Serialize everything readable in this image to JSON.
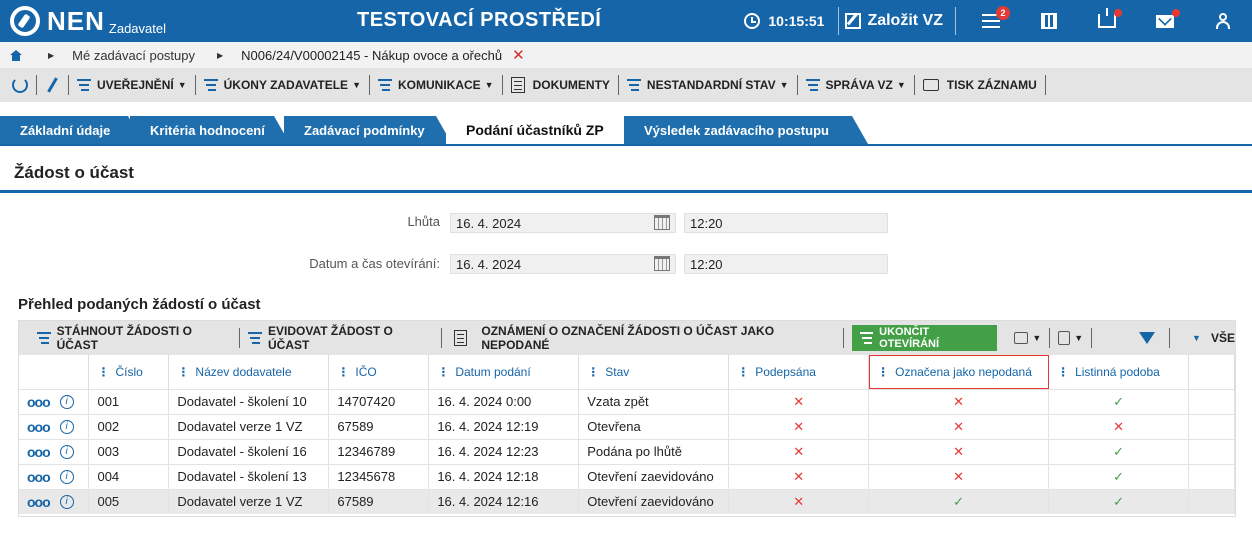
{
  "header": {
    "logo_text": "NEN",
    "logo_sub": "Zadavatel",
    "env_title": "TESTOVACÍ PROSTŘEDÍ",
    "clock": "10:15:51",
    "new_vz_label": "Založit VZ",
    "notif_count": "2",
    "accent": "#1565a8"
  },
  "breadcrumb": {
    "item1": "Mé zadávací postupy",
    "item2": "N006/24/V00002145 - Nákup ovoce a ořechů",
    "close": "✕"
  },
  "actionbar": {
    "items": [
      "UVEŘEJNĚNÍ",
      "ÚKONY ZADAVATELE",
      "KOMUNIKACE",
      "DOKUMENTY",
      "NESTANDARDNÍ STAV",
      "SPRÁVA VZ",
      "TISK ZÁZNAMU"
    ]
  },
  "tabs": [
    "Základní údaje",
    "Kritéria hodnocení",
    "Zadávací podmínky",
    "Podání účastníků ZP",
    "Výsledek zadávacího postupu"
  ],
  "section": {
    "title": "Žádost o účast",
    "lhuta_label": "Lhůta",
    "lhuta_date": "16. 4. 2024",
    "lhuta_time": "12:20",
    "opening_label": "Datum a čas otevírání:",
    "opening_date": "16. 4. 2024",
    "opening_time": "12:20"
  },
  "list": {
    "title": "Přehled podaných žádostí o účast",
    "toolbar": {
      "download": "STÁHNOUT ŽÁDOSTI O ÚČAST",
      "register": "EVIDOVAT ŽÁDOST O ÚČAST",
      "notice": "OZNÁMENÍ O OZNAČENÍ ŽÁDOSTI O ÚČAST JAKO NEPODANÉ",
      "finish": "UKONČIT OTEVÍRÁNÍ",
      "all": "VŠE"
    },
    "columns": [
      "Číslo",
      "Název dodavatele",
      "IČO",
      "Datum podání",
      "Stav",
      "Podepsána",
      "Označena jako nepodaná",
      "Listinná podoba"
    ],
    "rows": [
      {
        "cislo": "001",
        "nazev": "Dodavatel - školení 10",
        "ico": "14707420",
        "datum": "16. 4. 2024 0:00",
        "stav": "Vzata zpět",
        "podepsana": "✕",
        "nepodana": "✕",
        "listinna": "✓"
      },
      {
        "cislo": "002",
        "nazev": "Dodavatel verze 1 VZ",
        "ico": "67589",
        "datum": "16. 4. 2024 12:19",
        "stav": "Otevřena",
        "podepsana": "✕",
        "nepodana": "✕",
        "listinna": "✕"
      },
      {
        "cislo": "003",
        "nazev": "Dodavatel - školení 16",
        "ico": "12346789",
        "datum": "16. 4. 2024 12:23",
        "stav": "Podána po lhůtě",
        "podepsana": "✕",
        "nepodana": "✕",
        "listinna": "✓"
      },
      {
        "cislo": "004",
        "nazev": "Dodavatel - školení 13",
        "ico": "12345678",
        "datum": "16. 4. 2024 12:18",
        "stav": "Otevření zaevidováno",
        "podepsana": "✕",
        "nepodana": "✕",
        "listinna": "✓"
      },
      {
        "cislo": "005",
        "nazev": "Dodavatel verze 1 VZ",
        "ico": "67589",
        "datum": "16. 4. 2024 12:16",
        "stav": "Otevření zaevidováno",
        "podepsana": "✕",
        "nepodana": "✓",
        "listinna": "✓"
      }
    ]
  }
}
